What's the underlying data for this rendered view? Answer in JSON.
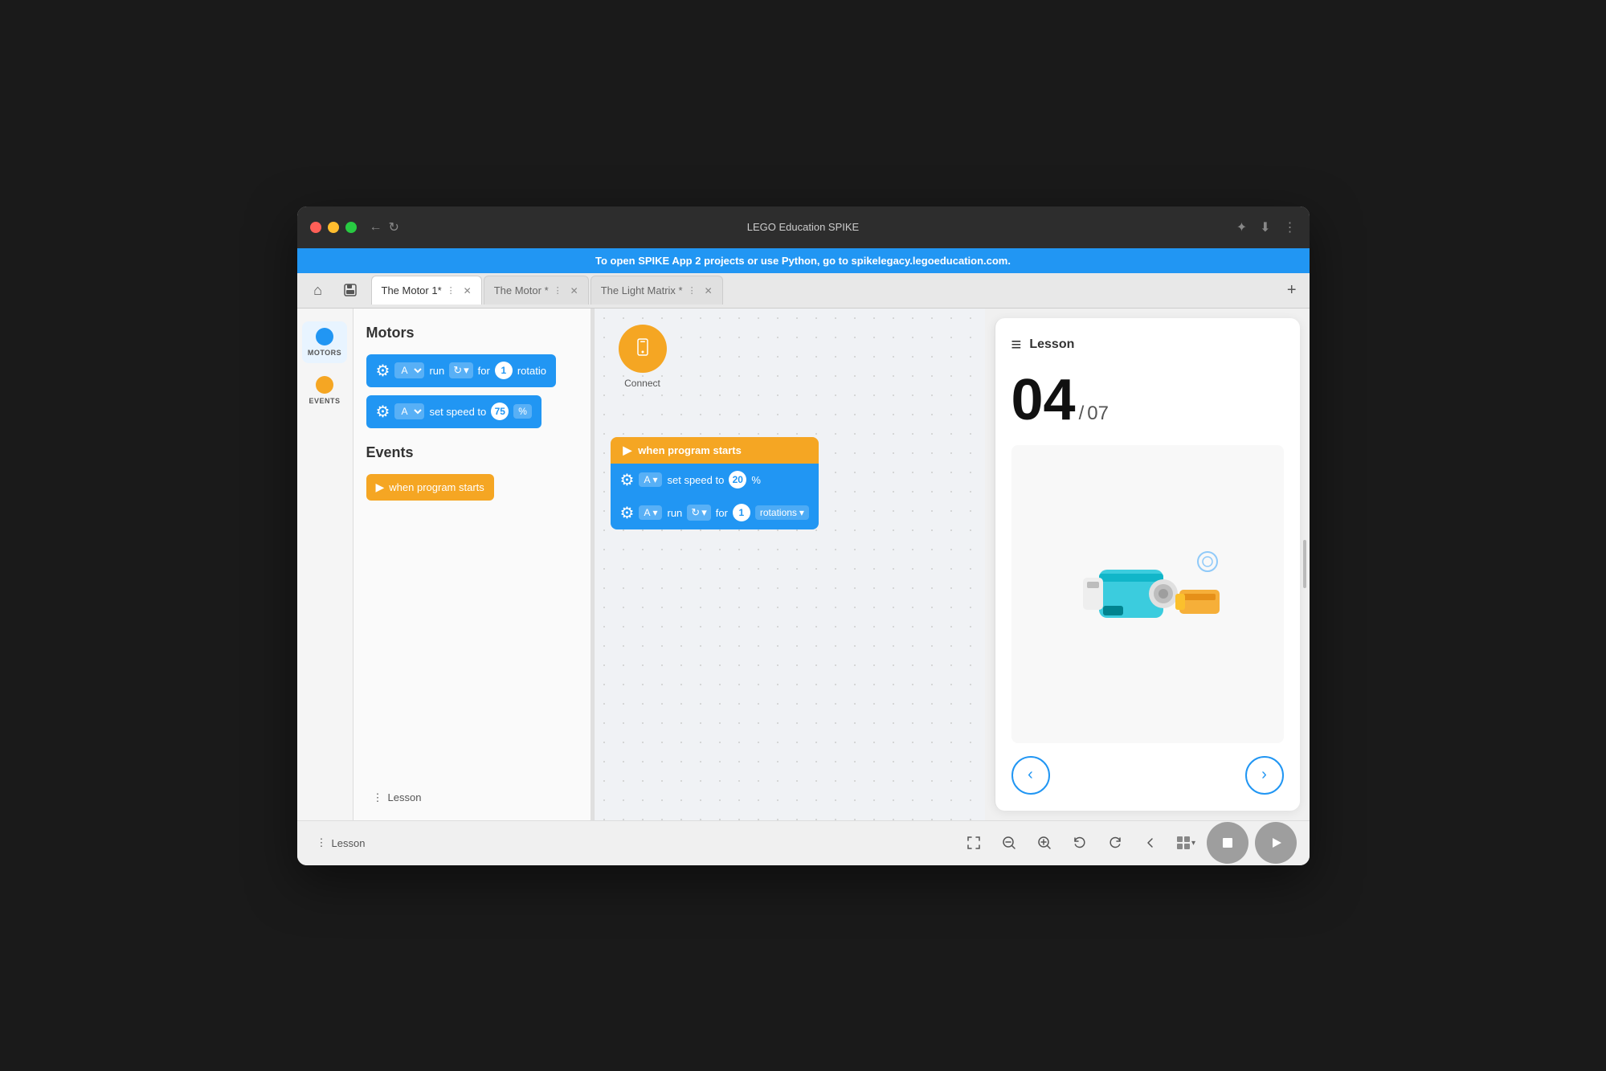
{
  "window": {
    "title": "LEGO Education SPIKE"
  },
  "banner": {
    "text": "To open SPIKE App 2 projects or use Python, go to ",
    "link": "spikelegacy.legoeducation.com."
  },
  "tabs": [
    {
      "label": "The Motor 1*",
      "active": true
    },
    {
      "label": "The Motor *",
      "active": false
    },
    {
      "label": "The Light Matrix *",
      "active": false
    }
  ],
  "sidebar": {
    "items": [
      {
        "label": "MOTORS",
        "color": "#2196f3",
        "active": true
      },
      {
        "label": "EVENTS",
        "color": "#f5a623",
        "active": false
      }
    ]
  },
  "blocks_panel": {
    "motors_title": "Motors",
    "events_title": "Events",
    "motor_block_1": {
      "port": "A",
      "action": "run",
      "for_value": "1",
      "unit": "rotatio"
    },
    "motor_block_2": {
      "port": "A",
      "action": "set speed to",
      "value": "75",
      "unit": "%"
    },
    "event_block_1": {
      "label": "when program starts"
    }
  },
  "canvas": {
    "connect_label": "Connect",
    "stack": {
      "trigger": "when program starts",
      "block1_port": "A",
      "block1_action": "set speed to",
      "block1_value": "20",
      "block1_unit": "%",
      "block2_port": "A",
      "block2_action": "run",
      "block2_for": "for",
      "block2_value": "1",
      "block2_unit": "rotations"
    }
  },
  "lesson": {
    "title": "Lesson",
    "current": "04",
    "separator": "/",
    "total": "07",
    "prev_label": "‹",
    "next_label": "›"
  },
  "bottom_toolbar": {
    "lesson_label": "Lesson",
    "zoom_in": "+",
    "zoom_out": "−",
    "undo": "↺",
    "redo": "↻",
    "collapse": "‹"
  }
}
